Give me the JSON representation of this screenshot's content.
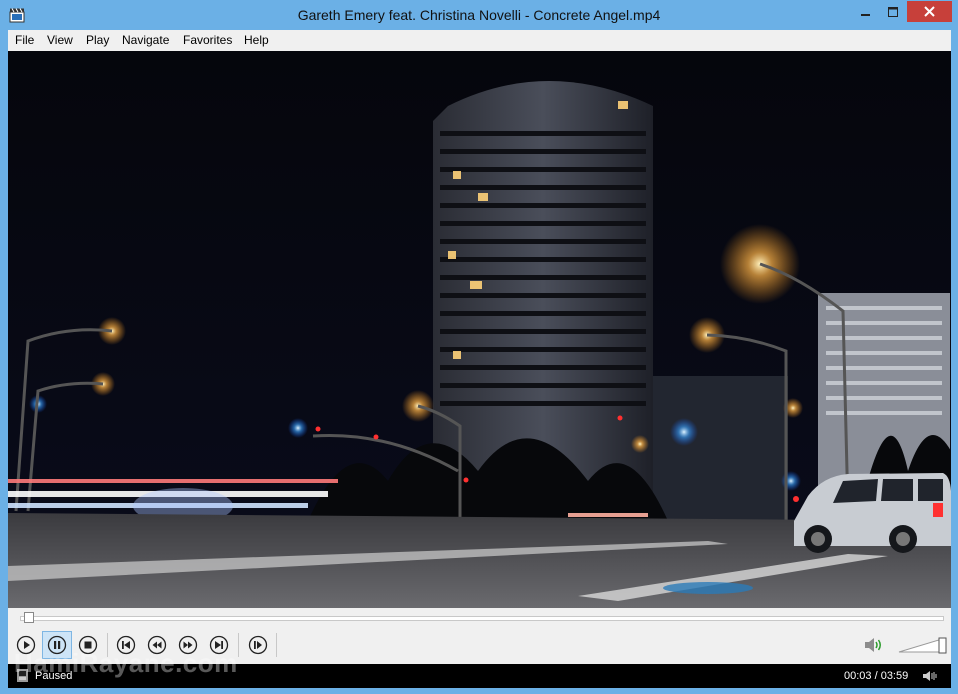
{
  "window": {
    "title": "Gareth Emery feat. Christina Novelli - Concrete Angel.mp4",
    "icon": "media-player-clapperboard-icon",
    "buttons": [
      "minimize-icon",
      "maximize-icon",
      "close-icon"
    ]
  },
  "menu": {
    "items": [
      "File",
      "View",
      "Play",
      "Navigate",
      "Favorites",
      "Help"
    ]
  },
  "video": {
    "scene": "night city street with tall cylindrical tower, street lights and traffic"
  },
  "controls": {
    "position_fraction": 0.0,
    "buttons": [
      {
        "name": "play-button",
        "icon": "play-icon"
      },
      {
        "name": "pause-button",
        "icon": "pause-icon",
        "active": true
      },
      {
        "name": "stop-button",
        "icon": "stop-icon"
      },
      {
        "name": "previous-button",
        "icon": "skip-previous-icon"
      },
      {
        "name": "rewind-button",
        "icon": "rewind-icon"
      },
      {
        "name": "fast-forward-button",
        "icon": "fast-forward-icon"
      },
      {
        "name": "next-button",
        "icon": "skip-next-icon"
      },
      {
        "name": "frame-step-button",
        "icon": "frame-step-icon"
      }
    ],
    "volume_icon": "speaker-icon"
  },
  "status": {
    "state": "Paused",
    "time": "00:03 / 03:59"
  },
  "watermark": "HamiRayane.com",
  "colors": {
    "titlebar": "#6bb0e6",
    "close": "#c7403a",
    "active_button": "#cde4f7"
  }
}
